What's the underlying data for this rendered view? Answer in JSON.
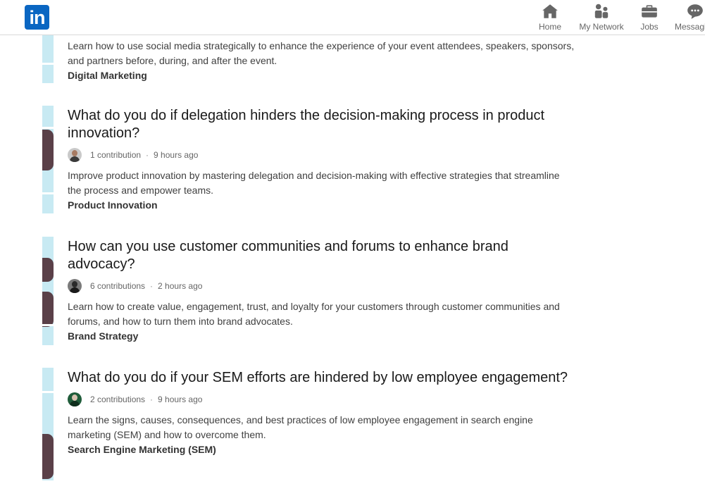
{
  "header": {
    "logo_text": "in",
    "nav": [
      {
        "label": "Home",
        "icon": "home-icon"
      },
      {
        "label": "My Network",
        "icon": "network-icon"
      },
      {
        "label": "Jobs",
        "icon": "briefcase-icon"
      },
      {
        "label": "Messagi",
        "icon": "messaging-icon"
      }
    ]
  },
  "articles": [
    {
      "desc": "Learn how to use social media strategically to enhance the experience of your event attendees, speakers, sponsors, and partners before, during, and after the event.",
      "skill": "Digital Marketing"
    },
    {
      "title": "What do you do if delegation hinders the decision-making process in product innovation?",
      "contributions": "1 contribution",
      "time": "9 hours ago",
      "desc": "Improve product innovation by mastering delegation and decision-making with effective strategies that streamline the process and empower teams.",
      "skill": "Product Innovation"
    },
    {
      "title": "How can you use customer communities and forums to enhance brand advocacy?",
      "contributions": "6 contributions",
      "time": "2 hours ago",
      "desc": "Learn how to create value, engagement, trust, and loyalty for your customers through customer communities and forums, and how to turn them into brand advocates.",
      "skill": "Brand Strategy"
    },
    {
      "title": "What do you do if your SEM efforts are hindered by low employee engagement?",
      "contributions": "2 contributions",
      "time": "9 hours ago",
      "desc": "Learn the signs, causes, consequences, and best practices of low employee engagement in search engine marketing (SEM) and how to overcome them.",
      "skill": "Search Engine Marketing (SEM)"
    }
  ],
  "separator": "·",
  "colors": {
    "brand": "#0a66c2",
    "thumb_bg": "#c8eaf3",
    "thumb_art": "#5a4048",
    "meta_text": "#666666"
  }
}
